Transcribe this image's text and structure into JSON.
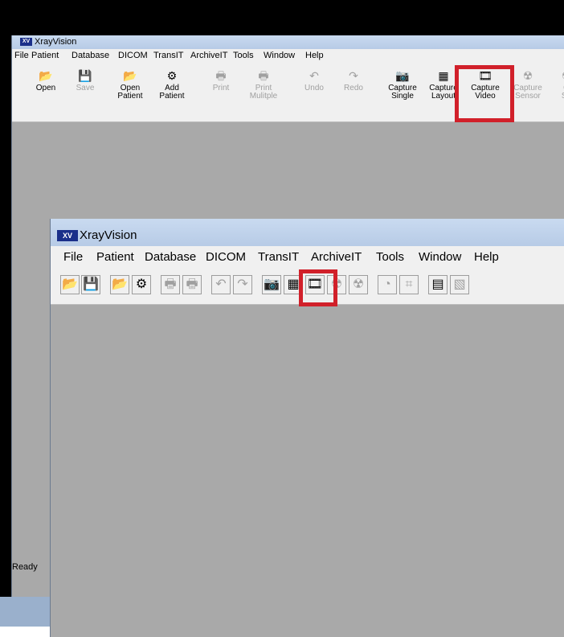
{
  "app": {
    "logo_text": "XV",
    "title": "XrayVision",
    "status": "Ready"
  },
  "menu": [
    "File",
    "Patient",
    "Database",
    "DICOM",
    "TransIT",
    "ArchiveIT",
    "Tools",
    "Window",
    "Help"
  ],
  "toolbar": {
    "buttons": [
      {
        "label": "Open",
        "icon": "open-folder-icon",
        "enabled": true
      },
      {
        "label": "Save",
        "icon": "save-disk-icon",
        "enabled": false
      },
      {
        "label": "Open\nPatient",
        "icon": "open-patient-icon",
        "enabled": true
      },
      {
        "label": "Add\nPatient",
        "icon": "add-patient-icon",
        "enabled": true
      },
      {
        "label": "Print",
        "icon": "printer-icon",
        "enabled": false
      },
      {
        "label": "Print\nMulitple",
        "icon": "print-multiple-icon",
        "enabled": false
      },
      {
        "label": "Undo",
        "icon": "undo-icon",
        "enabled": false
      },
      {
        "label": "Redo",
        "icon": "redo-icon",
        "enabled": false
      },
      {
        "label": "Capture\nSingle",
        "icon": "camera-icon",
        "enabled": true
      },
      {
        "label": "Capture\nLayout",
        "icon": "capture-layout-icon",
        "enabled": true
      },
      {
        "label": "Capture\nVideo",
        "icon": "film-icon",
        "enabled": true
      },
      {
        "label": "Capture\nSensor",
        "icon": "sensor-icon",
        "enabled": false
      },
      {
        "label": "Q\nSe",
        "icon": "q-sensor-icon",
        "enabled": false
      }
    ]
  },
  "highlight_color": "#d1202a"
}
